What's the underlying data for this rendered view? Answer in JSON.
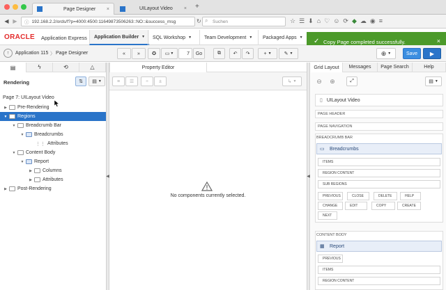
{
  "browser": {
    "tabs": [
      {
        "label": "Page Designer"
      },
      {
        "label": "UILayout Video"
      }
    ],
    "new_tab": "+",
    "url": "192.168.2.2/ords/f?p=4000:4500:11649873506263::NO::&success_msg",
    "search_placeholder": "Suchen"
  },
  "apex": {
    "brand": "ORACLE",
    "product": "Application Express",
    "nav_tabs": [
      "Application Builder",
      "SQL Workshop",
      "Team Development",
      "Packaged Apps"
    ],
    "toast": "Copy Page completed successfully."
  },
  "toolbar": {
    "application": "Application 115",
    "page_designer": "Page Designer",
    "page_number": "7",
    "go": "Go",
    "save": "Save"
  },
  "left": {
    "tabs": [
      "rendering-tab",
      "dynamic-actions-tab",
      "processing-tab",
      "shared-components-tab"
    ],
    "header": "Rendering",
    "tree": [
      {
        "label": "Page 7: UILayout Video",
        "level": 0,
        "type": "page"
      },
      {
        "label": "Pre-Rendering",
        "level": 0,
        "type": "folder"
      },
      {
        "label": "Regions",
        "level": 0,
        "type": "folder",
        "selected": true
      },
      {
        "label": "Breadcrumb Bar",
        "level": 1,
        "type": "folder"
      },
      {
        "label": "Breadcrumbs",
        "level": 2,
        "type": "region"
      },
      {
        "label": "Attributes",
        "level": 3,
        "type": "attr"
      },
      {
        "label": "Content Body",
        "level": 1,
        "type": "folder"
      },
      {
        "label": "Report",
        "level": 2,
        "type": "region"
      },
      {
        "label": "Columns",
        "level": 3,
        "type": "folder"
      },
      {
        "label": "Attributes",
        "level": 3,
        "type": "folder"
      },
      {
        "label": "Post-Rendering",
        "level": 0,
        "type": "folder"
      }
    ]
  },
  "middle": {
    "tab": "Property Editor",
    "empty_message": "No components currently selected."
  },
  "right": {
    "tabs": [
      "Grid Layout",
      "Messages",
      "Page Search",
      "Help"
    ],
    "page_title": "UILayout Video",
    "sections": {
      "page_header": "PAGE HEADER",
      "page_navigation": "PAGE NAVIGATION",
      "breadcrumb_bar": "BREADCRUMB BAR",
      "content_body": "CONTENT BODY"
    },
    "breadcrumbs_region": "Breadcrumbs",
    "breadcrumb_slots": [
      "ITEMS",
      "REGION CONTENT",
      "SUB REGIONS"
    ],
    "button_row1": [
      "PREVIOUS",
      "CLOSE",
      "DELETE",
      "HELP"
    ],
    "button_row2": [
      "CHANGE",
      "EDIT",
      "COPY",
      "CREATE"
    ],
    "button_row3": [
      "NEXT"
    ],
    "report_region": "Report",
    "report_slots": [
      "PREVIOUS",
      "ITEMS",
      "REGION CONTENT"
    ]
  }
}
